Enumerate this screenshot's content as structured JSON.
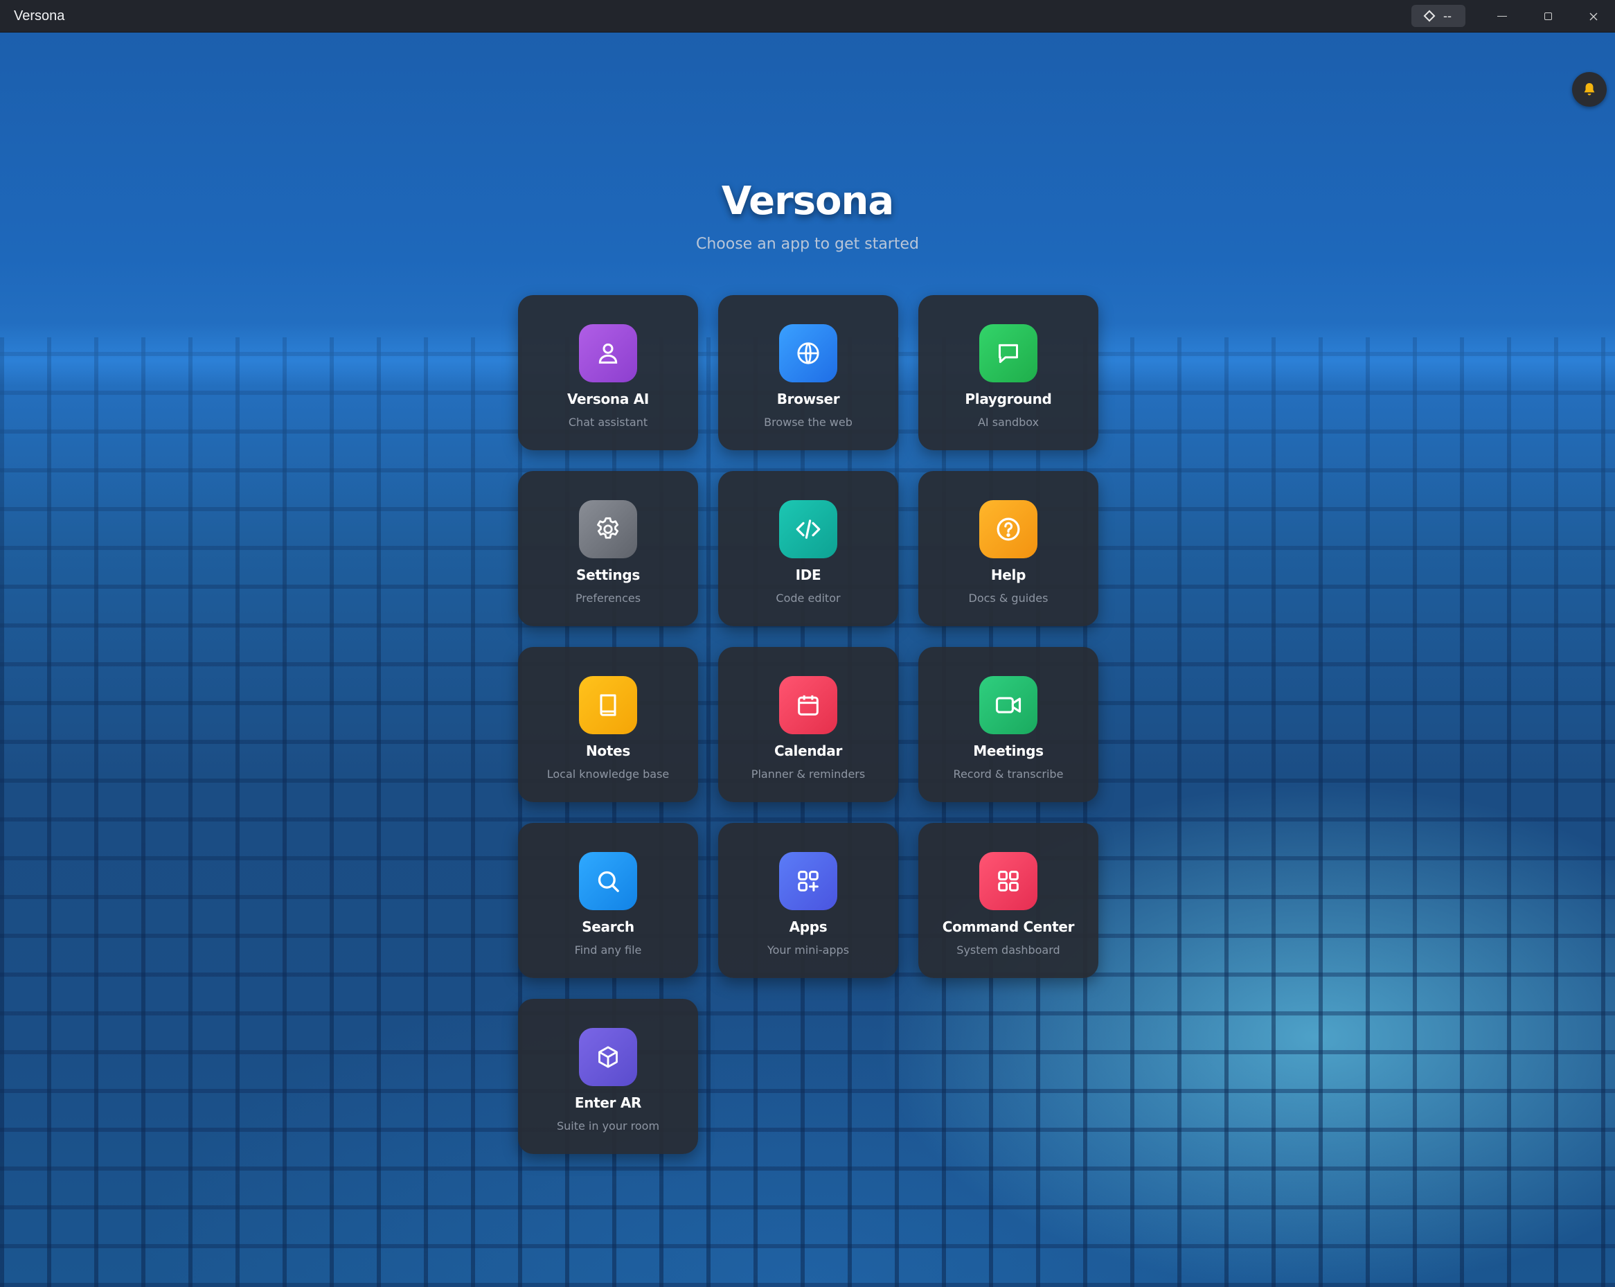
{
  "window": {
    "title": "Versona",
    "badge_text": "--"
  },
  "hero": {
    "title": "Versona",
    "subtitle": "Choose an app to get started"
  },
  "apps": [
    {
      "name": "Versona AI",
      "desc": "Chat assistant",
      "icon": "user-icon",
      "color": "#a24fd6"
    },
    {
      "name": "Browser",
      "desc": "Browse the web",
      "icon": "globe-icon",
      "color": "#2f8ff5"
    },
    {
      "name": "Playground",
      "desc": "AI sandbox",
      "icon": "chat-bubble-icon",
      "color": "#27c65a"
    },
    {
      "name": "Settings",
      "desc": "Preferences",
      "icon": "gear-icon",
      "color": "#777b83"
    },
    {
      "name": "IDE",
      "desc": "Code editor",
      "icon": "code-icon",
      "color": "#14b8a6"
    },
    {
      "name": "Help",
      "desc": "Docs & guides",
      "icon": "help-circle-icon",
      "color": "#fba01a"
    },
    {
      "name": "Notes",
      "desc": "Local knowledge base",
      "icon": "book-icon",
      "color": "#fbb30f"
    },
    {
      "name": "Calendar",
      "desc": "Planner & reminders",
      "icon": "calendar-icon",
      "color": "#f43f5e"
    },
    {
      "name": "Meetings",
      "desc": "Record & transcribe",
      "icon": "video-icon",
      "color": "#22c071"
    },
    {
      "name": "Search",
      "desc": "Find any file",
      "icon": "search-icon",
      "color": "#1e9bf3"
    },
    {
      "name": "Apps",
      "desc": "Your mini-apps",
      "icon": "apps-grid-icon",
      "color": "#4f6cf0"
    },
    {
      "name": "Command Center",
      "desc": "System dashboard",
      "icon": "dashboard-icon",
      "color": "#f43f5e"
    },
    {
      "name": "Enter AR",
      "desc": "Suite in your room",
      "icon": "cube-icon",
      "color": "#6a5ad8"
    }
  ]
}
